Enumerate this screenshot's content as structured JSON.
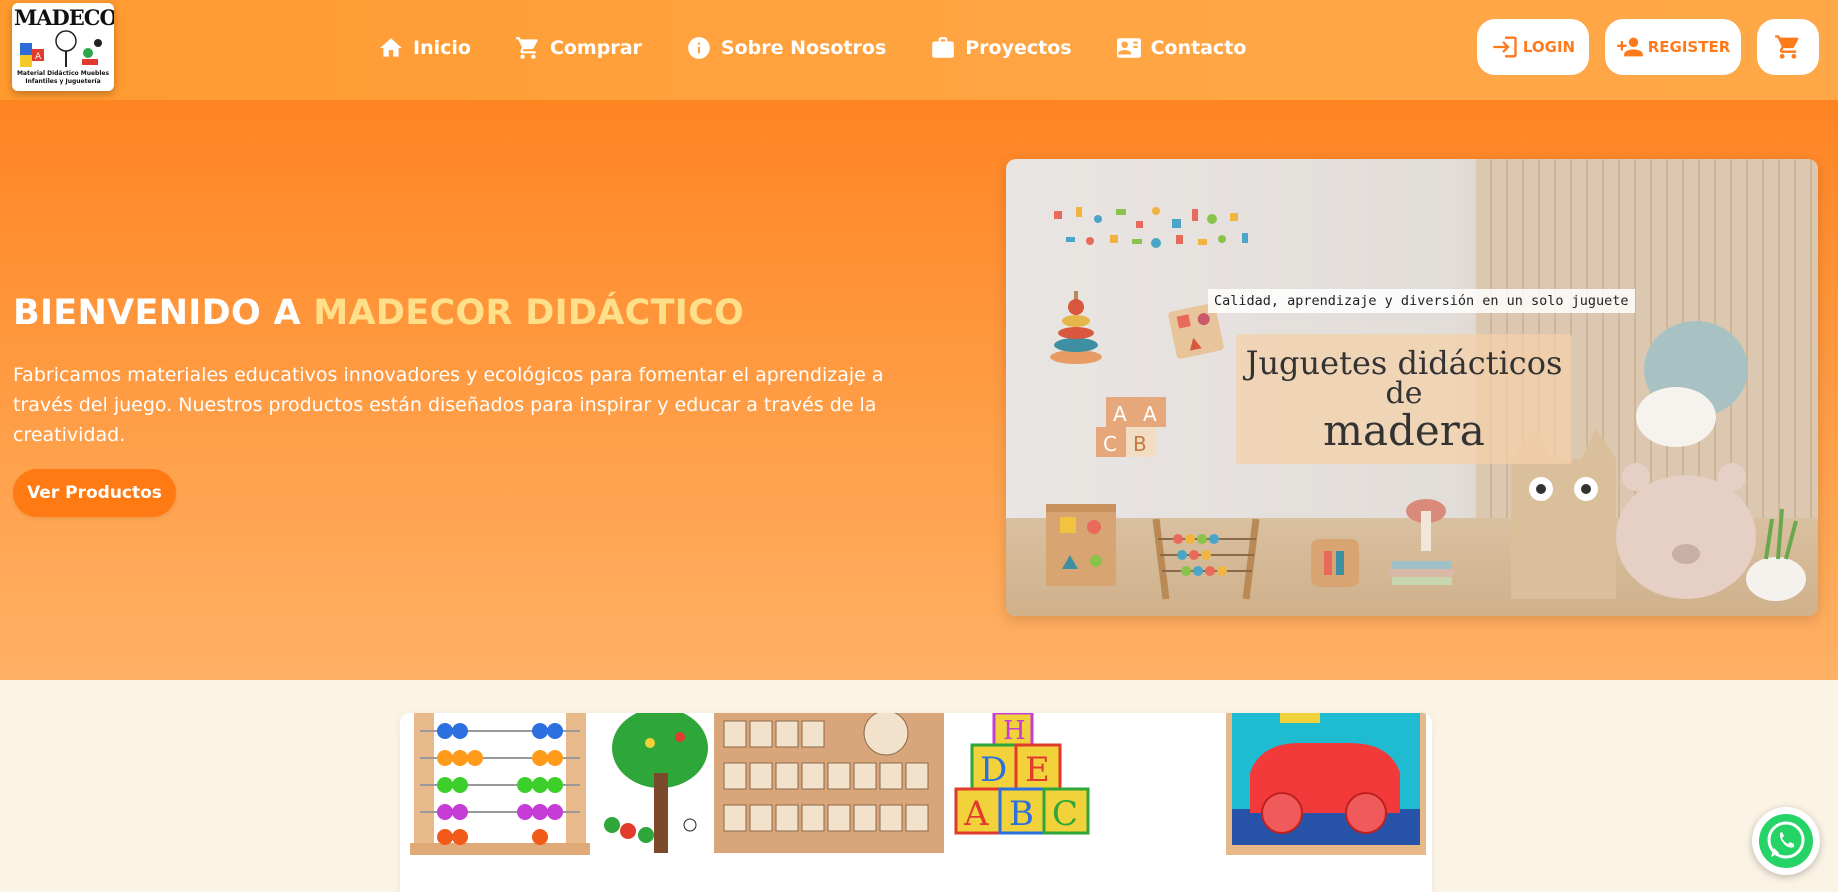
{
  "brand": {
    "logo_title": "MADECOR",
    "logo_subtitle": "Material Didáctico Muebles Infantiles y Juguetería"
  },
  "nav": {
    "items": [
      {
        "label": "Inicio",
        "icon": "home-icon"
      },
      {
        "label": "Comprar",
        "icon": "cart-icon"
      },
      {
        "label": "Sobre Nosotros",
        "icon": "info-icon"
      },
      {
        "label": "Proyectos",
        "icon": "briefcase-icon"
      },
      {
        "label": "Contacto",
        "icon": "contact-card-icon"
      }
    ],
    "login_label": "LOGIN",
    "register_label": "REGISTER"
  },
  "hero": {
    "title_prefix": "BIENVENIDO A ",
    "title_accent": "MADECOR DIDÁCTICO",
    "description": "Fabricamos materiales educativos innovadores y ecológicos para fomentar el aprendizaje a través del juego. Nuestros productos están diseñados para inspirar y educar a través de la creatividad.",
    "cta_label": "Ver Productos",
    "image": {
      "tagline": "Calidad, aprendizaje y diversión en un solo juguete",
      "line1": "Juguetes didácticos",
      "line2": "de",
      "line3": "madera"
    }
  },
  "gallery": {
    "items": [
      "abacus",
      "tree-toy",
      "bead-board",
      "abc-blocks",
      "car-puzzle"
    ],
    "blocks_letters": [
      "H",
      "D",
      "E",
      "A",
      "B",
      "C"
    ]
  },
  "colors": {
    "accent": "#ff7a12",
    "accent_text": "#ffe08a",
    "whatsapp": "#25d366"
  }
}
